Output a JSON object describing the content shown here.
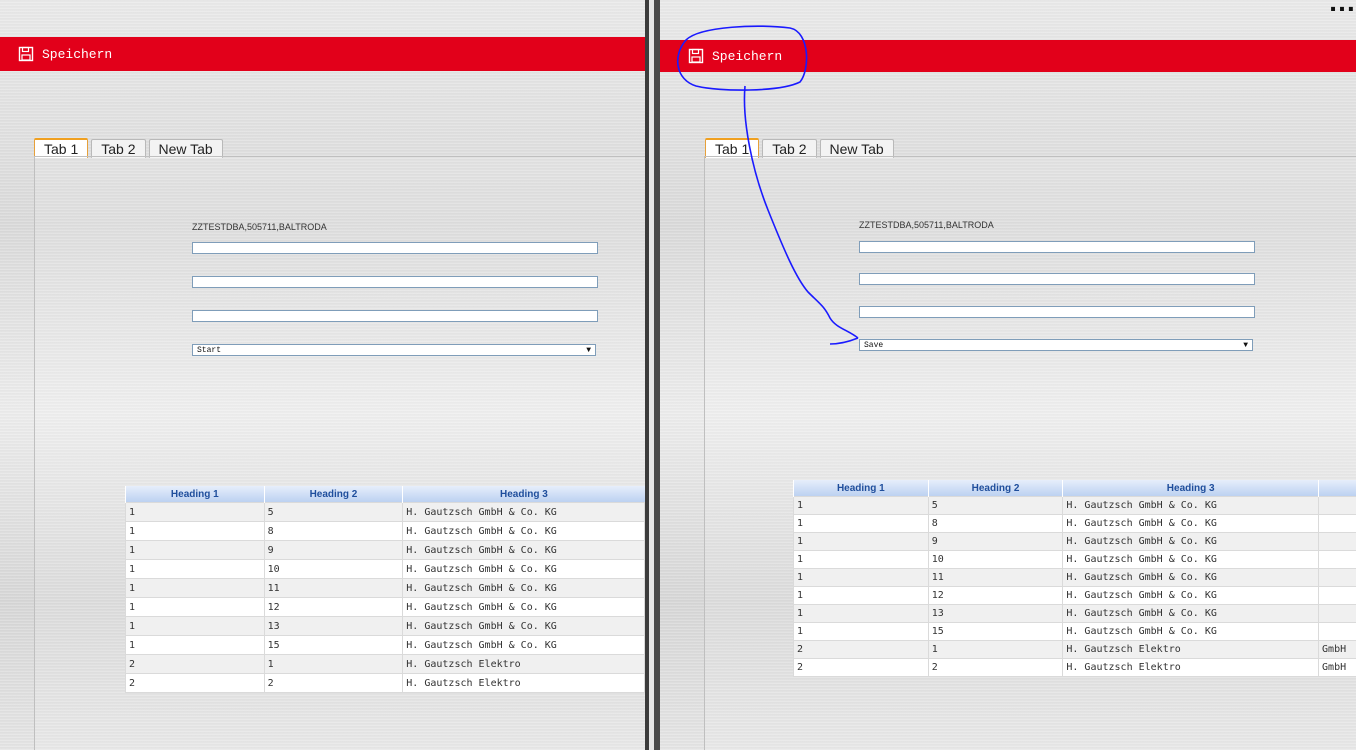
{
  "left": {
    "toolbar": {
      "save_label": "Speichern",
      "icon": "save-icon"
    },
    "tabs": [
      {
        "label": "Tab 1",
        "active": true
      },
      {
        "label": "Tab 2"
      },
      {
        "label": "New Tab"
      }
    ],
    "user_info": "ZZTESTDBA,505711,BALTRODA",
    "fields": [
      {
        "value": ""
      },
      {
        "value": ""
      },
      {
        "value": ""
      }
    ],
    "select": {
      "value": "Start"
    },
    "table": {
      "headers": [
        "Heading 1",
        "Heading 2",
        "Heading 3"
      ],
      "rows": [
        [
          "1",
          "5",
          "H. Gautzsch GmbH & Co. KG"
        ],
        [
          "1",
          "8",
          "H. Gautzsch GmbH & Co. KG"
        ],
        [
          "1",
          "9",
          "H. Gautzsch GmbH & Co. KG"
        ],
        [
          "1",
          "10",
          "H. Gautzsch GmbH & Co. KG"
        ],
        [
          "1",
          "11",
          "H. Gautzsch GmbH & Co. KG"
        ],
        [
          "1",
          "12",
          "H. Gautzsch GmbH & Co. KG"
        ],
        [
          "1",
          "13",
          "H. Gautzsch GmbH & Co. KG"
        ],
        [
          "1",
          "15",
          "H. Gautzsch GmbH & Co. KG"
        ],
        [
          "2",
          "1",
          "H. Gautzsch Elektro"
        ],
        [
          "2",
          "2",
          "H. Gautzsch Elektro"
        ]
      ]
    }
  },
  "right": {
    "top_text": "…",
    "toolbar": {
      "save_label": "Speichern",
      "icon": "save-icon"
    },
    "tabs": [
      {
        "label": "Tab 1",
        "active": true
      },
      {
        "label": "Tab 2"
      },
      {
        "label": "New Tab"
      }
    ],
    "user_info": "ZZTESTDBA,505711,BALTRODA",
    "fields": [
      {
        "value": ""
      },
      {
        "value": ""
      },
      {
        "value": ""
      }
    ],
    "select": {
      "value": "Save"
    },
    "table": {
      "headers": [
        "Heading 1",
        "Heading 2",
        "Heading 3",
        ""
      ],
      "rows": [
        [
          "1",
          "5",
          "H. Gautzsch GmbH & Co. KG",
          ""
        ],
        [
          "1",
          "8",
          "H. Gautzsch GmbH & Co. KG",
          ""
        ],
        [
          "1",
          "9",
          "H. Gautzsch GmbH & Co. KG",
          ""
        ],
        [
          "1",
          "10",
          "H. Gautzsch GmbH & Co. KG",
          ""
        ],
        [
          "1",
          "11",
          "H. Gautzsch GmbH & Co. KG",
          ""
        ],
        [
          "1",
          "12",
          "H. Gautzsch GmbH & Co. KG",
          ""
        ],
        [
          "1",
          "13",
          "H. Gautzsch GmbH & Co. KG",
          ""
        ],
        [
          "1",
          "15",
          "H. Gautzsch GmbH & Co. KG",
          ""
        ],
        [
          "2",
          "1",
          "H. Gautzsch Elektro",
          "GmbH"
        ],
        [
          "2",
          "2",
          "H. Gautzsch Elektro",
          "GmbH"
        ]
      ]
    }
  },
  "colors": {
    "brand_red": "#e2001a",
    "tab_active_accent": "#f0a020",
    "table_header_text": "#1f4e9c",
    "annotation_ink": "#1a1aff"
  }
}
